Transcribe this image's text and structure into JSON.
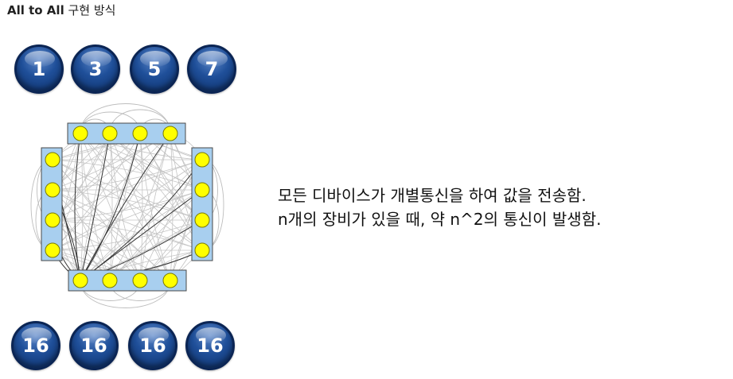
{
  "title": {
    "prefix": "All to All",
    "suffix": " 구현 방식"
  },
  "top_nodes": [
    "1",
    "3",
    "5",
    "7"
  ],
  "bottom_nodes": [
    "16",
    "16",
    "16",
    "16"
  ],
  "description": {
    "line1": "모든 디바이스가 개별통신을 하여 값을 전송함.",
    "line2": "n개의 장비가 있을 때, 약 n^2의 통신이 발생함."
  },
  "colors": {
    "node_fill": "#1f4f99",
    "bar_fill": "#a8cfef",
    "device_fill": "#ffff00",
    "device_stroke": "#7a7a00"
  }
}
